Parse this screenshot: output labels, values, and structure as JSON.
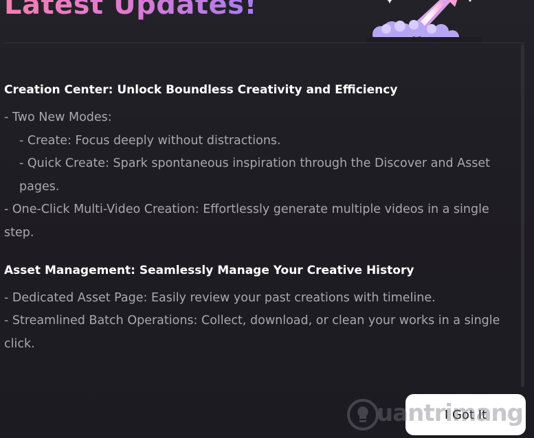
{
  "dialog": {
    "title": "Latest Updates!",
    "accent_gradient": [
      "#f07fb0",
      "#e07ad0",
      "#a77cf0"
    ],
    "background": "#1d1c22",
    "illustration": "rocket-launch-icon"
  },
  "sections": [
    {
      "heading": "Creation Center: Unlock Boundless Creativity and Efficiency",
      "items": [
        "- Two New Modes:",
        "- Create: Focus deeply without distractions.",
        "- Quick Create: Spark spontaneous inspiration through the Discover and Asset pages.",
        "- One-Click Multi-Video Creation: Effortlessly generate multiple videos in a single step."
      ]
    },
    {
      "heading": "Asset Management: Seamlessly Manage Your Creative History",
      "items": [
        "- Dedicated Asset Page: Easily review your past creations with timeline.",
        "- Streamlined Batch Operations: Collect, download, or clean your works in a single click."
      ]
    }
  ],
  "actions": {
    "confirm_label": "I Got It"
  },
  "watermark": {
    "text": "uantrimang",
    "icon": "lightbulb-icon"
  }
}
